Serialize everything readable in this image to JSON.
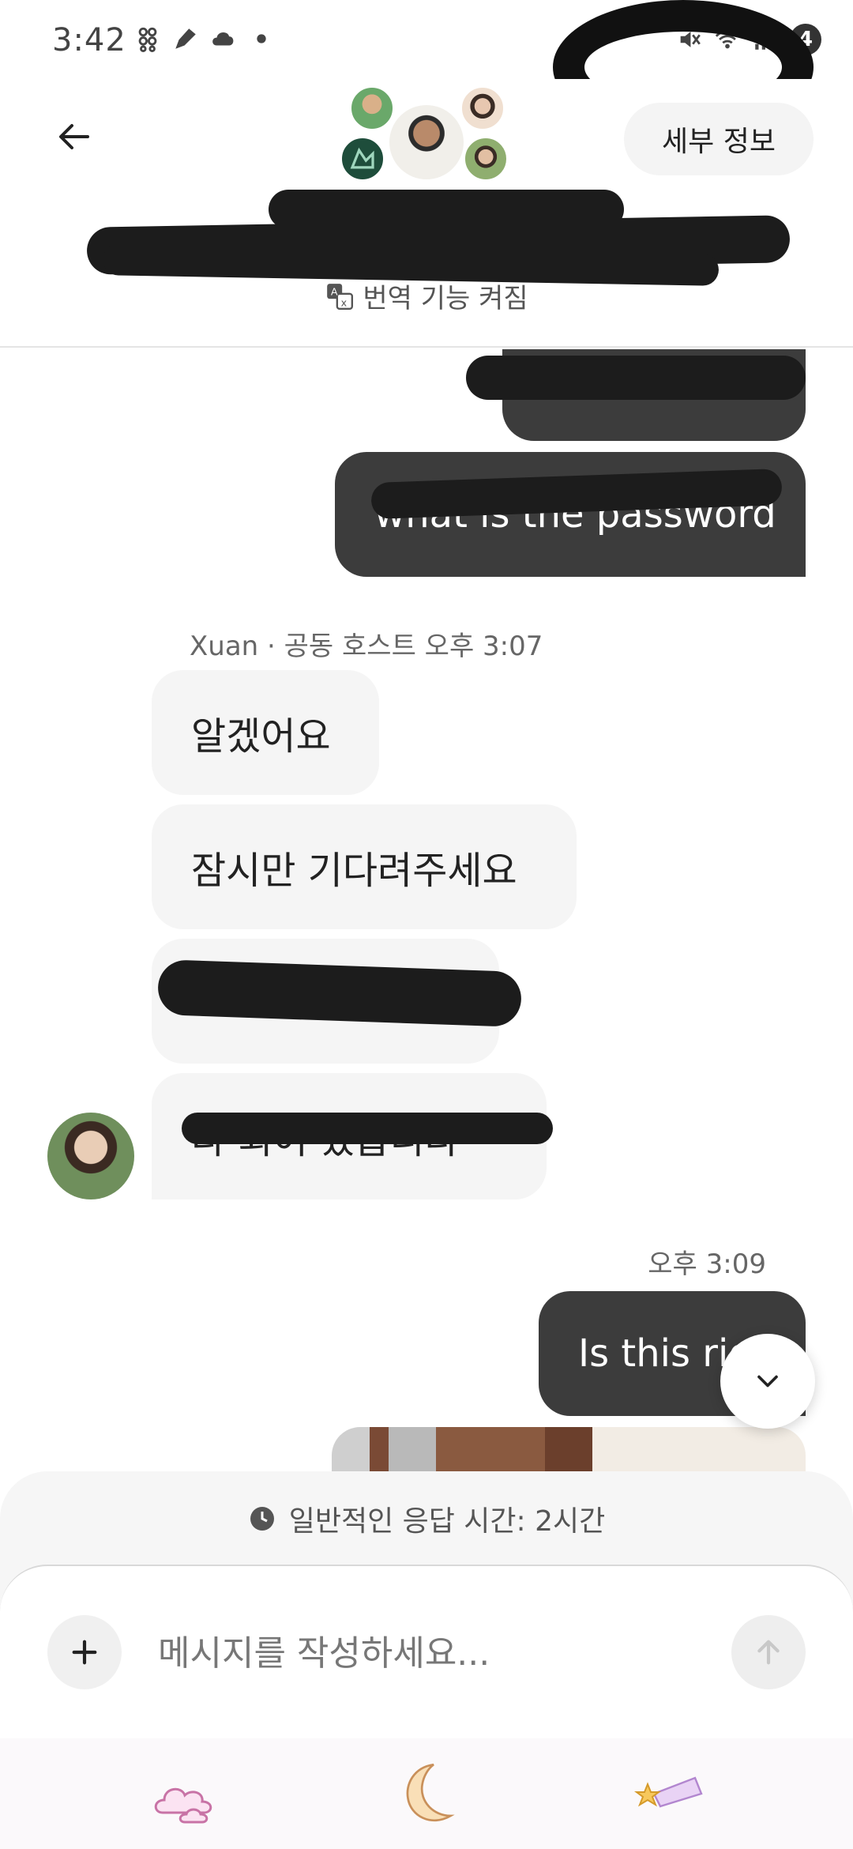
{
  "status_bar": {
    "time": "3:42",
    "battery_level": "4",
    "icons": [
      "app-notification-icon",
      "pen-icon",
      "cloud-icon",
      "dot-icon",
      "mute-icon",
      "wifi-icon",
      "signal-icon"
    ]
  },
  "header": {
    "details_label": "세부 정보",
    "translation_label": "번역 기능 켜짐"
  },
  "messages": {
    "outgoing_1": "what is the password",
    "sender_line": "Xuan · 공동 호스트 오후 3:07",
    "incoming_1": "알겠어요",
    "incoming_2": "잠시만 기다려주세요",
    "incoming_4": "다 되어 있습니다",
    "time_line": "오후 3:09",
    "outgoing_2": "Is this right"
  },
  "composer": {
    "response_time": "일반적인 응답 시간: 2시간",
    "input_placeholder": "메시지를 작성하세요..."
  },
  "keyboard_strip": {
    "icons": [
      "cloud-sticker-icon",
      "moon-sticker-icon",
      "shooting-star-sticker-icon"
    ]
  },
  "colors": {
    "outgoing_bubble": "#3c3c3c",
    "incoming_bubble": "#f5f5f5",
    "accent_text": "#222222"
  }
}
